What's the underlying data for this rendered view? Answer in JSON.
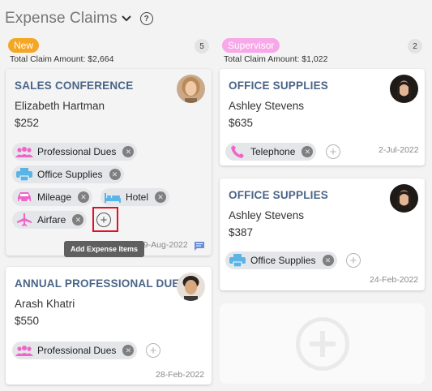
{
  "header": {
    "title": "Expense Claims",
    "help_label": "?"
  },
  "columns": [
    {
      "stage": "New",
      "count": "5",
      "total": "Total Claim Amount: $2,664",
      "cards": [
        {
          "title": "SALES CONFERENCE",
          "name": "Elizabeth Hartman",
          "amount": "$252",
          "date": "19-Aug-2022",
          "chips": [
            "Professional Dues",
            "Office Supplies",
            "Mileage",
            "Hotel",
            "Airfare"
          ],
          "tooltip": "Add Expense Items"
        },
        {
          "title": "ANNUAL PROFESSIONAL DUES",
          "name": "Arash Khatri",
          "amount": "$550",
          "date": "28-Feb-2022",
          "chips": [
            "Professional Dues"
          ]
        }
      ]
    },
    {
      "stage": "Supervisor",
      "count": "2",
      "total": "Total Claim Amount: $1,022",
      "cards": [
        {
          "title": "OFFICE SUPPLIES",
          "name": "Ashley Stevens",
          "amount": "$635",
          "date": "2-Jul-2022",
          "chips": [
            "Telephone"
          ]
        },
        {
          "title": "OFFICE SUPPLIES",
          "name": "Ashley Stevens",
          "amount": "$387",
          "date": "24-Feb-2022",
          "chips": [
            "Office Supplies"
          ]
        }
      ]
    }
  ],
  "colors": {
    "new_badge": "#f5a623",
    "supervisor_badge": "#f7a8e8",
    "title_blue": "#4a6487",
    "icon_pink": "#f065c8",
    "icon_blue": "#5ab4e6",
    "highlight_red": "#e0102a"
  },
  "icons": {
    "professional_dues": "people-group-icon",
    "office_supplies": "printer-icon",
    "mileage": "car-icon",
    "hotel": "bed-icon",
    "airfare": "airplane-icon",
    "telephone": "phone-icon",
    "comment": "comment-icon",
    "add": "add-circle-icon"
  }
}
